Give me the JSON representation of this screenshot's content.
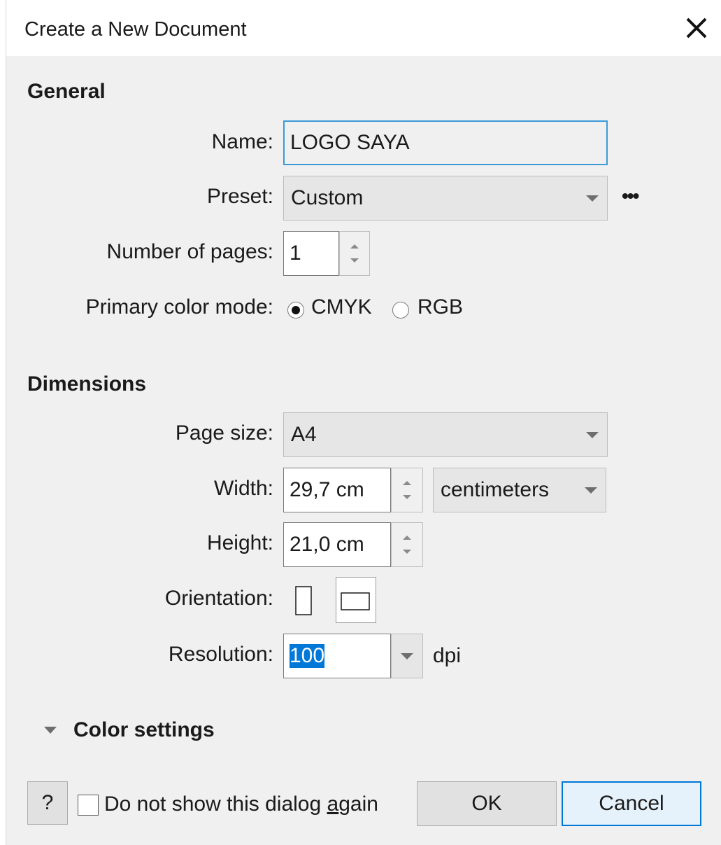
{
  "window": {
    "title": "Create a New Document",
    "close_glyph": "✕"
  },
  "general": {
    "section_title": "General",
    "name": {
      "label": "Name:",
      "value": "LOGO SAYA"
    },
    "preset": {
      "label": "Preset:",
      "value": "Custom",
      "more_glyph": "•••"
    },
    "pages": {
      "label": "Number of pages:",
      "value": "1"
    },
    "color_mode": {
      "label": "Primary color mode:",
      "options": [
        "CMYK",
        "RGB"
      ],
      "selected": "CMYK"
    }
  },
  "dimensions": {
    "section_title": "Dimensions",
    "page_size": {
      "label": "Page size:",
      "value": "A4"
    },
    "width": {
      "label": "Width:",
      "value": "29,7 cm",
      "unit": "centimeters"
    },
    "height": {
      "label": "Height:",
      "value": "21,0 cm"
    },
    "orientation": {
      "label": "Orientation:",
      "selected": "landscape"
    },
    "resolution": {
      "label": "Resolution:",
      "value": "100",
      "unit": "dpi"
    }
  },
  "color_settings": {
    "label": "Color settings",
    "expanded": false
  },
  "footer": {
    "help_label": "?",
    "dont_show_label_pre": "Do not show this dialog ",
    "dont_show_label_accel": "a",
    "dont_show_label_post": "gain",
    "dont_show_checked": false,
    "ok_label": "OK",
    "cancel_label": "Cancel"
  },
  "colors": {
    "focus_border": "#3b9ad8",
    "selection_bg": "#0078d7",
    "dialog_bg": "#f0f0f0"
  }
}
